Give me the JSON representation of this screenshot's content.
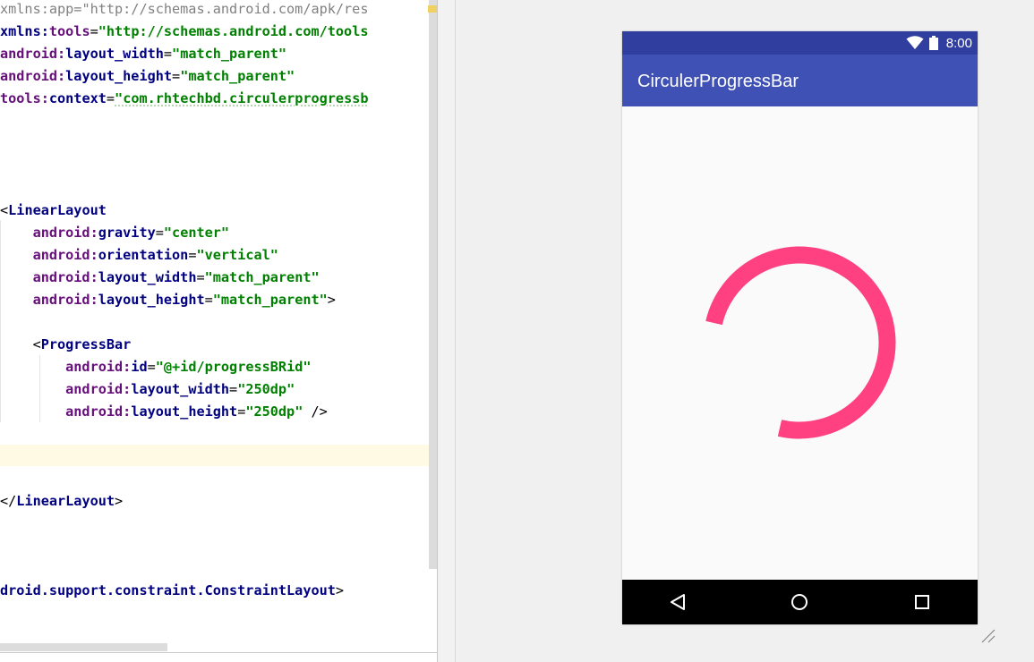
{
  "editor": {
    "lines": [
      [
        {
          "t": "xmlns:app=",
          "c": "t-gray"
        },
        {
          "t": "\"http://schemas.android.com/apk/res",
          "c": "t-gray"
        }
      ],
      [
        {
          "t": "xmlns:",
          "c": "t-attr"
        },
        {
          "t": "tools",
          "c": "t-ns"
        },
        {
          "t": "=",
          "c": "t-punc"
        },
        {
          "t": "\"http://schemas.android.com/tools",
          "c": "t-str"
        }
      ],
      [
        {
          "t": "android:",
          "c": "t-ns"
        },
        {
          "t": "layout_width",
          "c": "t-attr"
        },
        {
          "t": "=",
          "c": "t-punc"
        },
        {
          "t": "\"match_parent\"",
          "c": "t-str"
        }
      ],
      [
        {
          "t": "android:",
          "c": "t-ns"
        },
        {
          "t": "layout_height",
          "c": "t-attr"
        },
        {
          "t": "=",
          "c": "t-punc"
        },
        {
          "t": "\"match_parent\"",
          "c": "t-str"
        }
      ],
      [
        {
          "t": "tools:",
          "c": "t-ns"
        },
        {
          "t": "context",
          "c": "t-attr"
        },
        {
          "t": "=",
          "c": "t-punc"
        },
        {
          "t": "\"com.rhtechbd.circulerprogressb",
          "c": "t-str underline-wave"
        }
      ],
      [],
      [],
      [],
      [],
      [
        {
          "t": "<",
          "c": "t-punc"
        },
        {
          "t": "LinearLayout",
          "c": "t-tag"
        }
      ],
      [
        {
          "t": "    android:",
          "c": "t-ns"
        },
        {
          "t": "gravity",
          "c": "t-attr"
        },
        {
          "t": "=",
          "c": "t-punc"
        },
        {
          "t": "\"center\"",
          "c": "t-str"
        }
      ],
      [
        {
          "t": "    android:",
          "c": "t-ns"
        },
        {
          "t": "orientation",
          "c": "t-attr"
        },
        {
          "t": "=",
          "c": "t-punc"
        },
        {
          "t": "\"vertical\"",
          "c": "t-str"
        }
      ],
      [
        {
          "t": "    android:",
          "c": "t-ns"
        },
        {
          "t": "layout_width",
          "c": "t-attr"
        },
        {
          "t": "=",
          "c": "t-punc"
        },
        {
          "t": "\"match_parent\"",
          "c": "t-str"
        }
      ],
      [
        {
          "t": "    android:",
          "c": "t-ns"
        },
        {
          "t": "layout_height",
          "c": "t-attr"
        },
        {
          "t": "=",
          "c": "t-punc"
        },
        {
          "t": "\"match_parent\"",
          "c": "t-str"
        },
        {
          "t": ">",
          "c": "t-punc"
        }
      ],
      [],
      [
        {
          "t": "    <",
          "c": "t-punc"
        },
        {
          "t": "ProgressBar",
          "c": "t-tag"
        }
      ],
      [
        {
          "t": "        android:",
          "c": "t-ns"
        },
        {
          "t": "id",
          "c": "t-attr"
        },
        {
          "t": "=",
          "c": "t-punc"
        },
        {
          "t": "\"@+id/progressBRid\"",
          "c": "t-str"
        }
      ],
      [
        {
          "t": "        android:",
          "c": "t-ns"
        },
        {
          "t": "layout_width",
          "c": "t-attr"
        },
        {
          "t": "=",
          "c": "t-punc"
        },
        {
          "t": "\"250dp\"",
          "c": "t-str"
        }
      ],
      [
        {
          "t": "        android:",
          "c": "t-ns"
        },
        {
          "t": "layout_height",
          "c": "t-attr"
        },
        {
          "t": "=",
          "c": "t-punc"
        },
        {
          "t": "\"250dp\"",
          "c": "t-str"
        },
        {
          "t": " />",
          "c": "t-punc"
        }
      ],
      [],
      [],
      [],
      [
        {
          "t": "</",
          "c": "t-punc"
        },
        {
          "t": "LinearLayout",
          "c": "t-tag"
        },
        {
          "t": ">",
          "c": "t-punc"
        }
      ],
      [],
      [],
      [],
      [
        {
          "t": "droid.support.constraint.ConstraintLayout",
          "c": "t-tag"
        },
        {
          "t": ">",
          "c": "t-punc"
        }
      ]
    ]
  },
  "device": {
    "status_time": "8:00",
    "app_title": "CirculerProgressBar",
    "status_bar_color": "#303f9f",
    "app_bar_color": "#3f51b5",
    "progress_color": "#ff4081",
    "progress_arc": {
      "start_angle_deg": 283,
      "sweep_deg": 270
    },
    "icons": {
      "wifi": "wifi-icon",
      "battery": "battery-icon",
      "back": "back-triangle-icon",
      "home": "home-circle-icon",
      "recents": "recents-square-icon",
      "resize": "resize-grip-icon"
    }
  }
}
